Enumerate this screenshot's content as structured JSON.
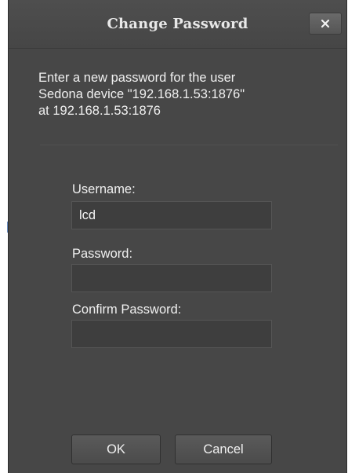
{
  "dialog": {
    "title": "Change Password",
    "close_icon": "close-x-icon",
    "message_lines": [
      "Enter a new password for the user",
      "Sedona device \"192.168.1.53:1876\"",
      "at 192.168.1.53:1876"
    ],
    "fields": {
      "username": {
        "label": "Username:",
        "value": "lcd",
        "placeholder": ""
      },
      "password": {
        "label": "Password:",
        "value": "",
        "placeholder": ""
      },
      "confirm_password": {
        "label": "Confirm Password:",
        "value": "",
        "placeholder": ""
      }
    },
    "buttons": {
      "ok_label": "OK",
      "cancel_label": "Cancel"
    }
  },
  "colors": {
    "dialog_background": "#474747",
    "input_background": "#3e3e3e",
    "text": "#f0f0f0"
  }
}
